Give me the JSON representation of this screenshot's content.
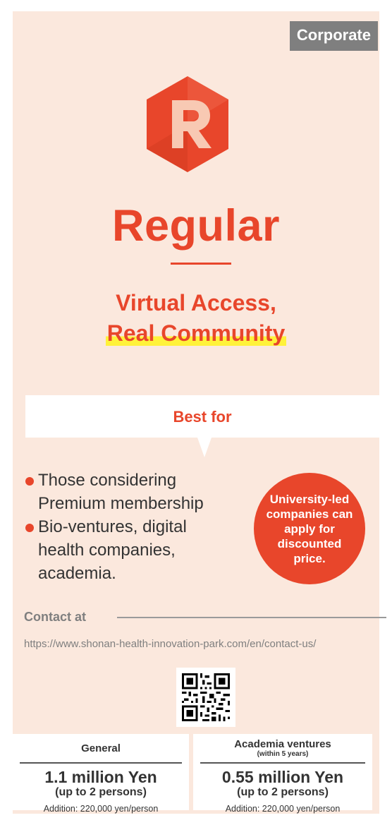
{
  "badge": "Corporate",
  "logo": {
    "letter": "R",
    "color": "#e8462b"
  },
  "plan_title": "Regular",
  "tagline": {
    "line1": "Virtual Access,",
    "line2": "Real Community"
  },
  "best_for": {
    "label": "Best for",
    "items": [
      "Those considering Premium membership",
      "Bio-ventures, digital health companies, academia."
    ]
  },
  "discount_circle": "University-led companies can apply for discounted price.",
  "contact": {
    "label": "Contact at",
    "url": "https://www.shonan-health-innovation-park.com/en/contact-us/"
  },
  "prices": [
    {
      "category": "General",
      "subcategory": "",
      "price": "1.1 million Yen",
      "persons": "(up to 2 persons)",
      "addition": "Addition: 220,000 yen/person"
    },
    {
      "category": "Academia ventures",
      "subcategory": "(within 5 years)",
      "price": "0.55 million Yen",
      "persons": "(up to 2 persons)",
      "addition": "Addition: 220,000 yen/person"
    }
  ],
  "colors": {
    "accent": "#e8462b",
    "background": "#fbe8dd",
    "highlight": "#fff23a",
    "badge": "#7f7f7f"
  }
}
